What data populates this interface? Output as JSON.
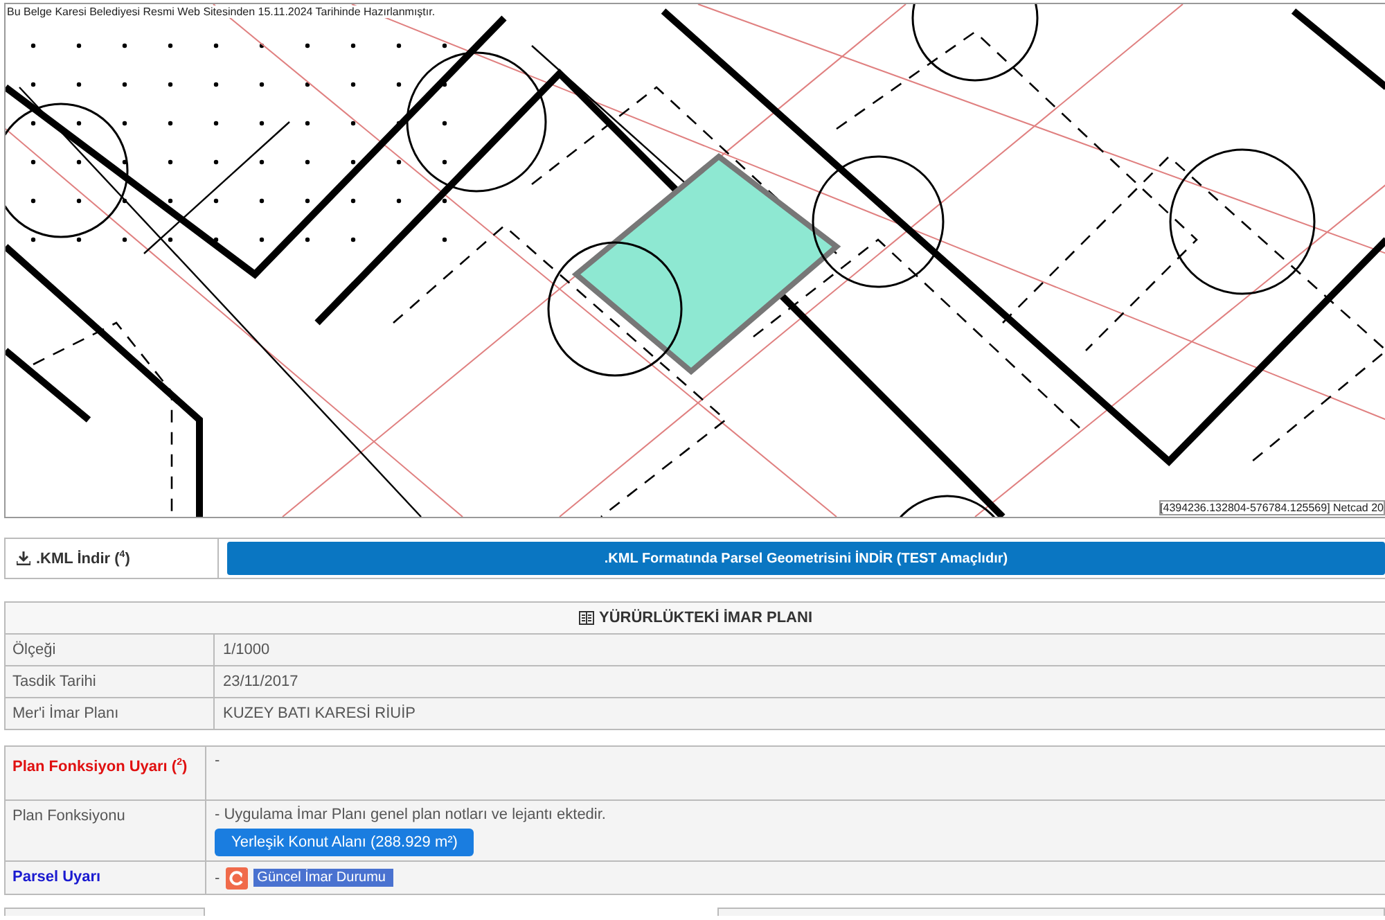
{
  "map": {
    "header_note": "Bu Belge Karesi Belediyesi Resmi Web Sitesinden 15.11.2024 Tarihinde Hazırlanmıştır.",
    "coordinates_note": "[4394236.132804-576784.125569] Netcad 20"
  },
  "kml": {
    "label": ".KML İndir ($^{4}$)",
    "button": ".KML Formatında Parsel Geometrisini İNDİR (TEST Amaçlıdır)"
  },
  "plan": {
    "title": "YÜRÜRLÜKTEKİ İMAR PLANI",
    "rows": [
      {
        "label": "Ölçeği",
        "value": "1/1000"
      },
      {
        "label": "Tasdik Tarihi",
        "value": "23/11/2017"
      },
      {
        "label": "Mer'i İmar Planı",
        "value": "KUZEY BATI KARESİ RİUİP"
      }
    ]
  },
  "function_table": {
    "rows": [
      {
        "kind": "warning",
        "label": "Plan Fonksiyon Uyarı ($^{2}$)",
        "value": "-"
      },
      {
        "kind": "function",
        "label": "Plan Fonksiyonu",
        "value": "- Uygulama İmar Planı genel plan notları ve lejantı ektedir.",
        "button": "Yerleşik Konut Alanı (288.929 m²)"
      },
      {
        "kind": "parcel",
        "label": "Parsel Uyarı",
        "value": "-",
        "link": "Güncel İmar Durumu"
      }
    ]
  }
}
